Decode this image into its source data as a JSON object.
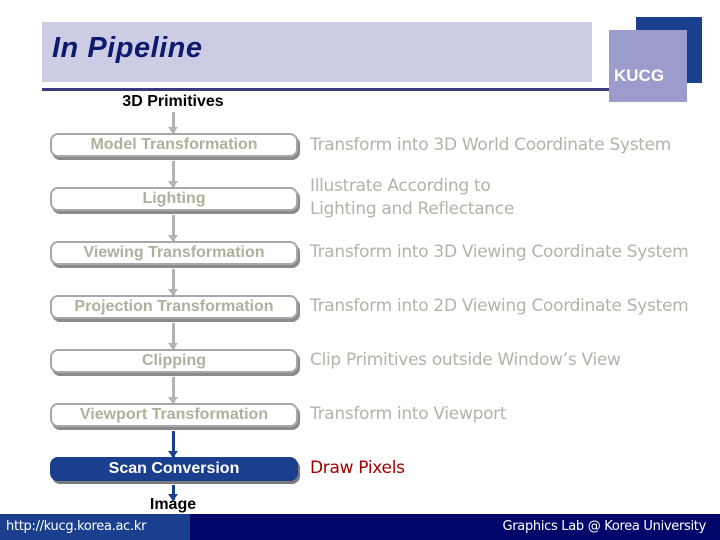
{
  "header": {
    "title": "In Pipeline",
    "logo_text": "KUCG"
  },
  "pipeline": {
    "input_label": "3D Primitives",
    "output_label": "Image",
    "stages": [
      {
        "name": "Model Transformation",
        "description": [
          "Transform into 3D World Coordinate System"
        ],
        "active": false
      },
      {
        "name": "Lighting",
        "description": [
          "Illustrate According to",
          "Lighting and Reflectance"
        ],
        "active": false
      },
      {
        "name": "Viewing Transformation",
        "description": [
          "Transform into 3D Viewing Coordinate System"
        ],
        "active": false
      },
      {
        "name": "Projection Transformation",
        "description": [
          "Transform into 2D Viewing Coordinate System"
        ],
        "active": false
      },
      {
        "name": "Clipping",
        "description": [
          "Clip Primitives outside Window’s View"
        ],
        "active": false
      },
      {
        "name": "Viewport Transformation",
        "description": [
          "Transform into Viewport"
        ],
        "active": false
      },
      {
        "name": "Scan Conversion",
        "description": [
          "Draw Pixels"
        ],
        "active": true
      }
    ]
  },
  "colors": {
    "active_box": "#1b3f8f",
    "inactive_text": "#b0b09c",
    "active_description": "#a00000",
    "title": "#0d1a6e",
    "footer": "#00056a"
  },
  "footer": {
    "url": "http://kucg.korea.ac.kr",
    "credit": "Graphics Lab @ Korea University"
  }
}
